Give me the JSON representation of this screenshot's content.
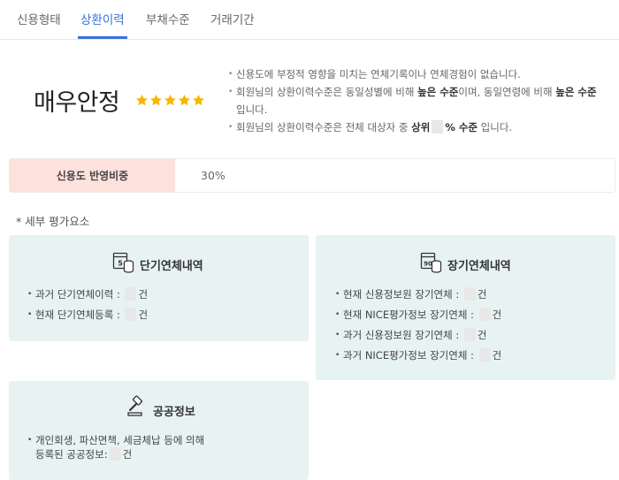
{
  "tabs": [
    {
      "label": "신용형태",
      "active": false
    },
    {
      "label": "상환이력",
      "active": true
    },
    {
      "label": "부채수준",
      "active": false
    },
    {
      "label": "거래기간",
      "active": false
    }
  ],
  "rating": {
    "level": "매우안정",
    "stars": 5,
    "star_color": "#f5b700"
  },
  "summary": {
    "line1": "신용도에 부정적 영향을 미치는 연체기록이나 연체경험이 없습니다.",
    "line2_pre": "회원님의 상환이력수준은 동일성별에 비해 ",
    "line2_b1": "높은 수준",
    "line2_mid": "이며, 동일연령에 비해 ",
    "line2_b2": "높은 수준",
    "line2_post": "입니다.",
    "line3_pre": "회원님의 상환이력수준은 전체 대상자 중 ",
    "line3_b1": "상위",
    "line3_b2": "% 수준",
    "line3_post": " 입니다."
  },
  "weight": {
    "label": "신용도 반영비중",
    "value": "30%"
  },
  "section_title": "* 세부 평가요소",
  "cards": {
    "short": {
      "title": "단기연체내역",
      "icon": "calendar-5-coins-icon",
      "items": [
        {
          "label": "과거 단기연체이력 : ",
          "unit": "건"
        },
        {
          "label": "현재 단기연체등록 : ",
          "unit": "건"
        }
      ]
    },
    "long": {
      "title": "장기연체내역",
      "icon": "calendar-90-coins-icon",
      "items": [
        {
          "label": "현재 신용정보원 장기연체 : ",
          "unit": "건"
        },
        {
          "label": "현재 NICE평가정보 장기연체 : ",
          "unit": "건"
        },
        {
          "label": "과거 신용정보원 장기연체 : ",
          "unit": "건"
        },
        {
          "label": "과거 NICE평가정보 장기연체 : ",
          "unit": "건"
        }
      ]
    },
    "public": {
      "title": "공공정보",
      "icon": "gavel-icon",
      "line1": "개인회생, 파산면책, 세금체납 등에 의해",
      "line2": "등록된 공공정보:",
      "unit": "건"
    }
  },
  "colors": {
    "accent": "#3a6fd8",
    "weight_bg": "#fde1dd",
    "card_bg": "#e7f3f2"
  }
}
